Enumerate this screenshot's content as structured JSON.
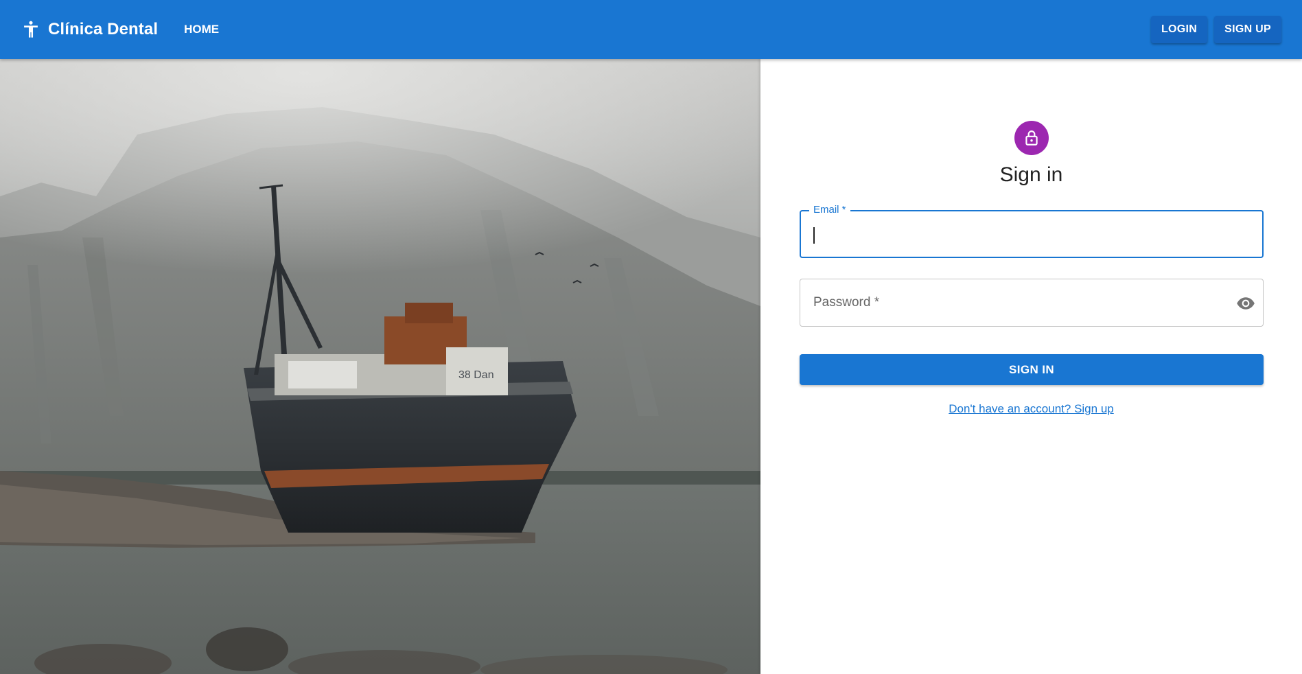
{
  "appbar": {
    "brand_title": "Clínica Dental",
    "brand_icon": "accessibility-icon",
    "nav_home": "HOME",
    "login_label": "LOGIN",
    "signup_label": "SIGN UP",
    "background_color": "#1976d2"
  },
  "hero": {
    "image_kind": "photo",
    "boat_name": "38 Dan"
  },
  "signin": {
    "avatar_icon": "lock-icon",
    "avatar_color": "#9c27b0",
    "title": "Sign in",
    "email": {
      "label": "Email *",
      "value": ""
    },
    "password": {
      "placeholder": "Password *",
      "value": "",
      "toggle_icon": "eye-icon"
    },
    "submit_label": "SIGN IN",
    "signup_link": "Don't have an account? Sign up"
  }
}
